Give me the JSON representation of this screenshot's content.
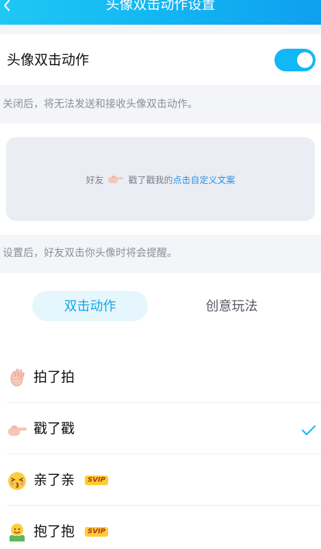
{
  "header": {
    "title": "头像双击动作设置"
  },
  "toggle": {
    "label": "头像双击动作",
    "enabled": true,
    "accent_color": "#12b7f5"
  },
  "hints": {
    "toggle_hint": "关闭后，将无法发送和接收头像双击动作。",
    "preview_hint": "设置后，好友双击你头像时将会提醒。"
  },
  "preview": {
    "friend_text": "好友",
    "action_text": "戳了戳我的",
    "link_text": "点击自定义文案"
  },
  "tabs": [
    {
      "label": "双击动作",
      "active": true
    },
    {
      "label": "创意玩法",
      "active": false
    }
  ],
  "actions": [
    {
      "label": "拍了拍",
      "icon": "waving-hand-icon",
      "svip": false,
      "selected": false
    },
    {
      "label": "戳了戳",
      "icon": "pointing-hand-icon",
      "svip": false,
      "selected": true
    },
    {
      "label": "亲了亲",
      "icon": "kissing-face-icon",
      "svip": true,
      "selected": false
    },
    {
      "label": "抱了抱",
      "icon": "hugging-face-icon",
      "svip": true,
      "selected": false
    }
  ],
  "badge": {
    "svip_label": "SVIP"
  }
}
